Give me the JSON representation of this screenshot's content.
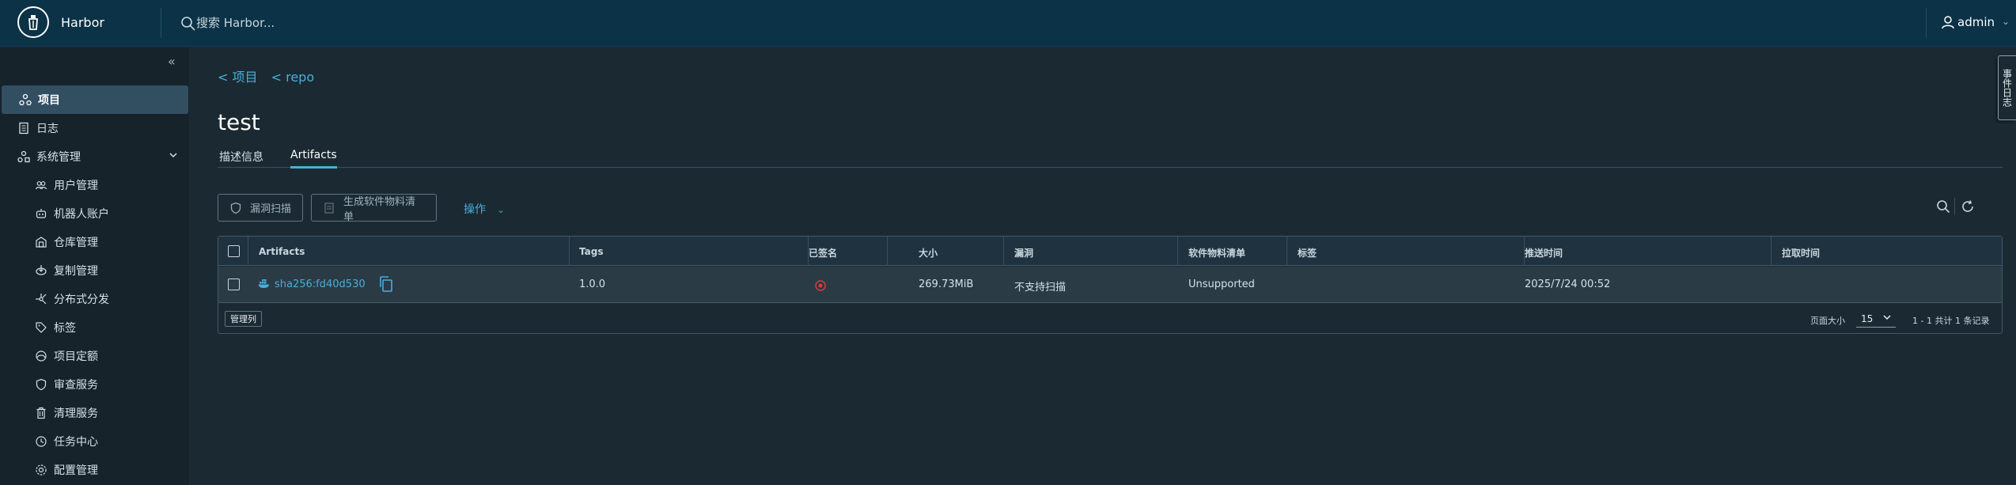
{
  "header": {
    "brand": "Harbor",
    "search_placeholder": "搜索 Harbor...",
    "user": "admin"
  },
  "sidebar": {
    "items": [
      {
        "label": "项目",
        "icon": "projects-icon",
        "active": true
      },
      {
        "label": "日志",
        "icon": "log-icon"
      },
      {
        "label": "系统管理",
        "icon": "admin-icon"
      },
      {
        "label": "用户管理",
        "icon": "users-icon"
      },
      {
        "label": "机器人账户",
        "icon": "robot-icon"
      },
      {
        "label": "仓库管理",
        "icon": "registry-icon"
      },
      {
        "label": "复制管理",
        "icon": "replication-icon"
      },
      {
        "label": "分布式分发",
        "icon": "distribution-icon"
      },
      {
        "label": "标签",
        "icon": "tag-icon"
      },
      {
        "label": "项目定额",
        "icon": "quota-icon"
      },
      {
        "label": "审查服务",
        "icon": "shield-icon"
      },
      {
        "label": "清理服务",
        "icon": "trash-icon"
      },
      {
        "label": "任务中心",
        "icon": "job-icon"
      },
      {
        "label": "配置管理",
        "icon": "gear-icon"
      }
    ]
  },
  "edge_tab": "事件日志",
  "breadcrumb": {
    "project": "< 项目",
    "repo": "< repo"
  },
  "page_title": "test",
  "tabs": [
    {
      "label": "描述信息"
    },
    {
      "label": "Artifacts",
      "active": true
    }
  ],
  "toolbar": {
    "scan_label": "漏洞扫描",
    "sbom_label": "生成软件物料清单",
    "action_label": "操作"
  },
  "table": {
    "columns": [
      "Artifacts",
      "Tags",
      "已签名",
      "大小",
      "漏洞",
      "软件物料清单",
      "标签",
      "推送时间",
      "拉取时间"
    ],
    "rows": [
      {
        "artifact": "sha256:fd40d530",
        "tags": "1.0.0",
        "signed": "",
        "size": "269.73MiB",
        "vulnerabilities": "不支持扫描",
        "sbom": "Unsupported",
        "labels": "",
        "push_time": "2025/7/24 00:52",
        "pull_time": ""
      }
    ],
    "footer": {
      "manage_columns": "管理列",
      "page_size_label": "页面大小",
      "page_size": "15",
      "total": "1 - 1 共计 1 条记录"
    }
  },
  "colors": {
    "header_bg": "#0b3246",
    "sidebar_bg": "#16232b",
    "content_bg": "#1b2a32",
    "accent": "#4aaed9",
    "active_nav": "#324f62",
    "unsigned": "#e0393e"
  }
}
